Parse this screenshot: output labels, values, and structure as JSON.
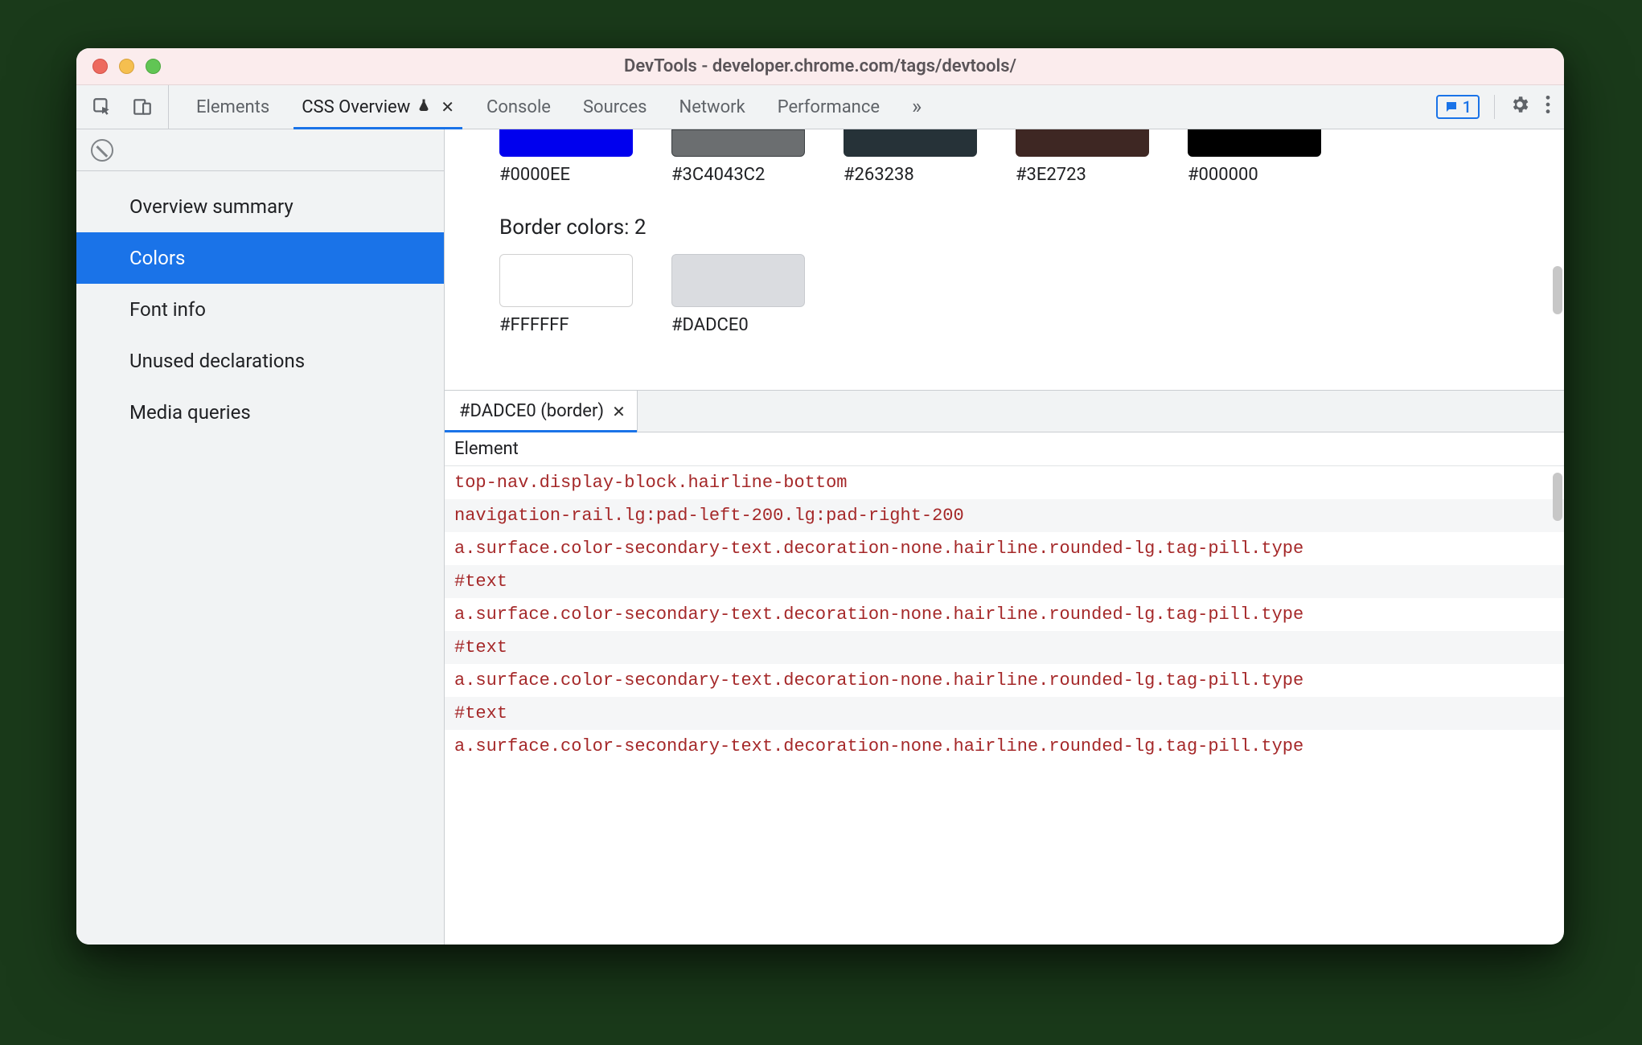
{
  "window": {
    "title": "DevTools - developer.chrome.com/tags/devtools/"
  },
  "tabbar": {
    "tabs": [
      {
        "label": "Elements"
      },
      {
        "label": "CSS Overview",
        "experimental": true,
        "closable": true,
        "active": true
      },
      {
        "label": "Console"
      },
      {
        "label": "Sources"
      },
      {
        "label": "Network"
      },
      {
        "label": "Performance"
      }
    ],
    "badge_count": "1"
  },
  "sidebar": {
    "items": [
      {
        "label": "Overview summary"
      },
      {
        "label": "Colors",
        "selected": true
      },
      {
        "label": "Font info"
      },
      {
        "label": "Unused declarations"
      },
      {
        "label": "Media queries"
      }
    ]
  },
  "colors": {
    "top_row": [
      {
        "hex": "#0000EE"
      },
      {
        "hex": "#3C4043C2",
        "display": "#3C4043"
      },
      {
        "hex": "#263238"
      },
      {
        "hex": "#3E2723"
      },
      {
        "hex": "#000000"
      }
    ],
    "border_heading": "Border colors: 2",
    "border_row": [
      {
        "hex": "#FFFFFF"
      },
      {
        "hex": "#DADCE0"
      }
    ]
  },
  "detail": {
    "tab_label": "#DADCE0 (border)",
    "column_header": "Element",
    "rows": [
      "top-nav.display-block.hairline-bottom",
      "navigation-rail.lg:pad-left-200.lg:pad-right-200",
      "a.surface.color-secondary-text.decoration-none.hairline.rounded-lg.tag-pill.type",
      "#text",
      "a.surface.color-secondary-text.decoration-none.hairline.rounded-lg.tag-pill.type",
      "#text",
      "a.surface.color-secondary-text.decoration-none.hairline.rounded-lg.tag-pill.type",
      "#text",
      "a.surface.color-secondary-text.decoration-none.hairline.rounded-lg.tag-pill.type"
    ]
  }
}
